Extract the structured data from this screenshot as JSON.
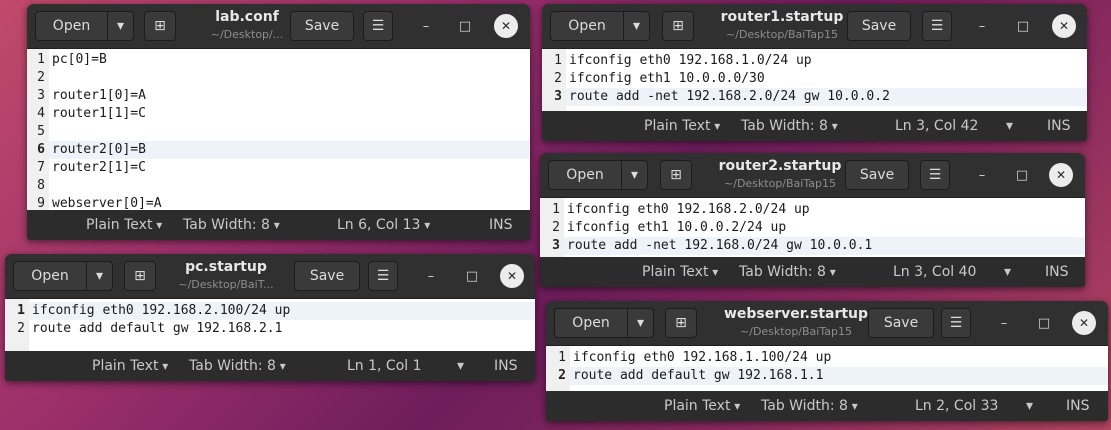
{
  "common": {
    "open_label": "Open",
    "save_label": "Save",
    "caret_glyph": "▾",
    "new_tab_glyph": "⊞",
    "menu_glyph": "☰",
    "min_glyph": "–",
    "max_glyph": "□",
    "close_glyph": "✕",
    "plain_text": "Plain Text",
    "tab_width": "Tab Width: 8",
    "ins": "INS"
  },
  "windows": {
    "lab": {
      "title": "lab.conf",
      "subtitle": "~/Desktop/...",
      "cursor": "Ln 6, Col 13",
      "lines": [
        "pc[0]=B",
        "",
        "router1[0]=A",
        "router1[1]=C",
        "",
        "router2[0]=B",
        "router2[1]=C",
        "",
        "webserver[0]=A"
      ],
      "nums": [
        "1",
        "2",
        "3",
        "4",
        "5",
        "6",
        "7",
        "8",
        "9"
      ],
      "current_line": 6
    },
    "r1": {
      "title": "router1.startup",
      "subtitle": "~/Desktop/BaiTap15",
      "cursor": "Ln 3, Col 42",
      "lines": [
        "ifconfig eth0 192.168.1.0/24 up",
        "ifconfig eth1 10.0.0.0/30",
        "route add -net 192.168.2.0/24 gw 10.0.0.2"
      ],
      "nums": [
        "1",
        "2",
        "3"
      ],
      "current_line": 3
    },
    "r2": {
      "title": "router2.startup",
      "subtitle": "~/Desktop/BaiTap15",
      "cursor": "Ln 3, Col 40",
      "lines": [
        "ifconfig eth0 192.168.2.0/24 up",
        "ifconfig eth1 10.0.0.2/24 up",
        "route add -net 192.168.0/24 gw 10.0.0.1"
      ],
      "nums": [
        "1",
        "2",
        "3"
      ],
      "current_line": 3
    },
    "pc": {
      "title": "pc.startup",
      "subtitle": "~/Desktop/BaiT...",
      "cursor": "Ln 1, Col 1",
      "lines": [
        "ifconfig eth0 192.168.2.100/24 up",
        "route add default gw 192.168.2.1"
      ],
      "nums": [
        "1",
        "2"
      ],
      "current_line": 1
    },
    "ws": {
      "title": "webserver.startup",
      "subtitle": "~/Desktop/BaiTap15",
      "cursor": "Ln 2, Col 33",
      "lines": [
        "ifconfig eth0 192.168.1.100/24 up",
        "route add default gw 192.168.1.1"
      ],
      "nums": [
        "1",
        "2"
      ],
      "current_line": 2
    }
  }
}
